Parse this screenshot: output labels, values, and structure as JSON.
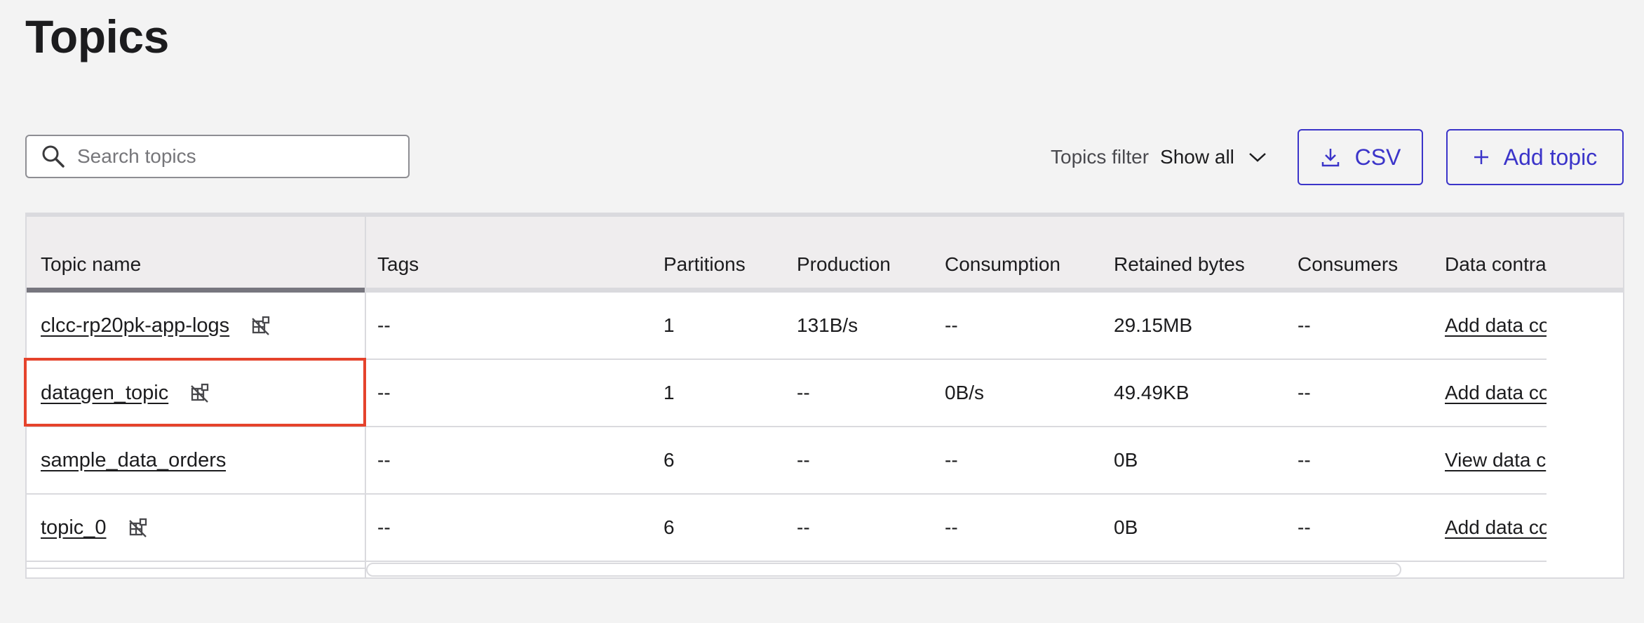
{
  "page": {
    "title": "Topics"
  },
  "search": {
    "placeholder": "Search topics",
    "value": ""
  },
  "filter": {
    "label": "Topics filter",
    "value": "Show all"
  },
  "actions": {
    "csv_label": "CSV",
    "add_topic_label": "Add topic"
  },
  "colors": {
    "accent": "#3b34c9",
    "highlight": "#e5432c"
  },
  "icons": {
    "search": "search-icon",
    "chevron": "chevron-down-icon",
    "download": "download-icon",
    "plus": "plus-icon",
    "no_schema": "no-schema-icon"
  },
  "table": {
    "columns": [
      "Topic name",
      "Tags",
      "Partitions",
      "Production",
      "Consumption",
      "Retained bytes",
      "Consumers",
      "Data contra"
    ],
    "rows": [
      {
        "name": "clcc-rp20pk-app-logs",
        "no_schema": true,
        "tags": "--",
        "partitions": "1",
        "production": "131B/s",
        "consumption": "--",
        "retained": "29.15MB",
        "consumers": "--",
        "contract": "Add data co"
      },
      {
        "name": "datagen_topic",
        "no_schema": true,
        "tags": "--",
        "partitions": "1",
        "production": "--",
        "consumption": "0B/s",
        "retained": "49.49KB",
        "consumers": "--",
        "contract": "Add data co",
        "highlighted": true
      },
      {
        "name": "sample_data_orders",
        "no_schema": false,
        "tags": "--",
        "partitions": "6",
        "production": "--",
        "consumption": "--",
        "retained": "0B",
        "consumers": "--",
        "contract": "View data c"
      },
      {
        "name": "topic_0",
        "no_schema": true,
        "tags": "--",
        "partitions": "6",
        "production": "--",
        "consumption": "--",
        "retained": "0B",
        "consumers": "--",
        "contract": "Add data co"
      }
    ]
  }
}
